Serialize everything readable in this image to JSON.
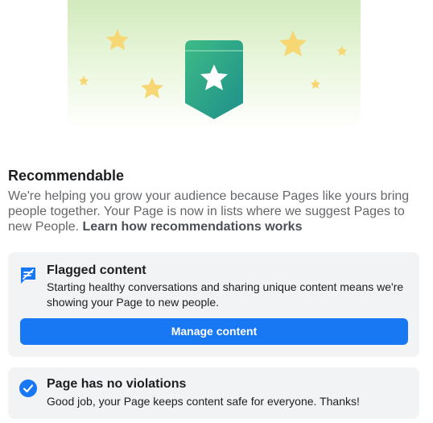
{
  "section": {
    "title": "Recommendable",
    "description": "We're helping you grow your audience because Pages like yours bring people together. Your Page is now in lists where we suggest Pages to new People.",
    "link_text": "Learn how recommendations works"
  },
  "flagged_card": {
    "icon": "flag-icon",
    "title": "Flagged content",
    "text": "Starting healthy conversations and sharing unique content means we're showing your Page to new people.",
    "button_label": "Manage content"
  },
  "violations_card": {
    "icon": "check-circle-icon",
    "title": "Page has no violations",
    "text": "Good job, your Page keeps content safe for everyone. Thanks!"
  },
  "colors": {
    "accent": "#1877f2",
    "badge_green": "#2aa37a",
    "star_yellow": "#f7d774",
    "card_bg": "#f2f3f5"
  }
}
